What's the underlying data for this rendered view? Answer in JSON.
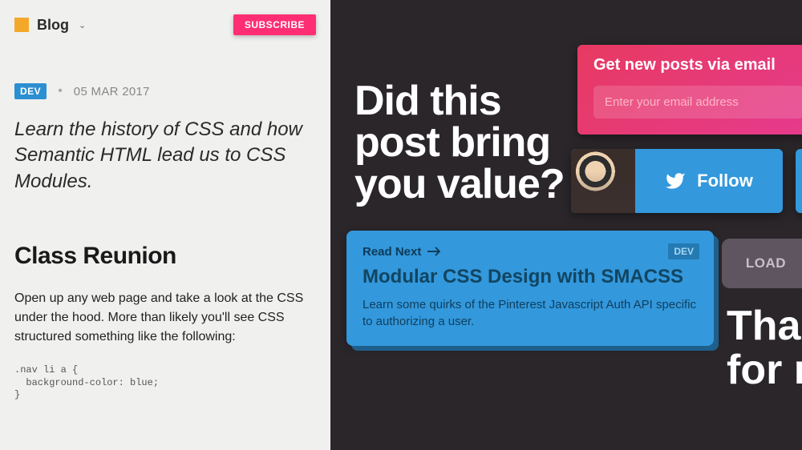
{
  "header": {
    "brand": "Blog",
    "subscribe": "SUBSCRIBE"
  },
  "post": {
    "tag": "DEV",
    "date": "05 MAR 2017",
    "intro": "Learn the history of CSS and how Semantic HTML lead us to CSS Modules.",
    "section_title": "Class Reunion",
    "body": "Open up any web page and take a look at the CSS under the hood. More than likely you'll see CSS structured something like the following:",
    "code": ".nav li a {\n  background-color: blue;\n}"
  },
  "cta": {
    "big_question_l1": "Did this",
    "big_question_l2": "post bring",
    "big_question_l3": "you value?",
    "newsletter_title": "Get new posts via email",
    "newsletter_placeholder": "Enter your email address",
    "follow_label": "Follow",
    "load_label": "LOAD",
    "thanks_l1": "Tha",
    "thanks_l2": "for r"
  },
  "read_next": {
    "label": "Read Next",
    "tag": "DEV",
    "title": "Modular CSS Design with SMACSS",
    "desc": "Learn some quirks of the Pinterest Javascript Auth API specific to authorizing a user."
  },
  "icons": {
    "twitter": "twitter-icon",
    "arrow": "arrow-right-icon",
    "chevron": "chevron-down-icon"
  }
}
